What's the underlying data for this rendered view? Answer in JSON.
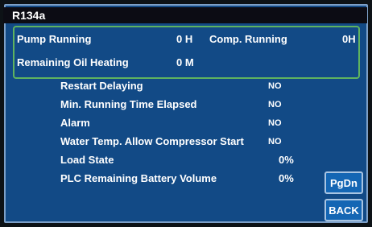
{
  "header": {
    "title": "R134a"
  },
  "status": {
    "pump_label": "Pump Running",
    "pump_value": "0 H",
    "comp_label": "Comp. Running",
    "comp_value": "0H",
    "oil_label": "Remaining Oil Heating",
    "oil_value": "0 M"
  },
  "conditions": [
    {
      "label": "Restart Delaying",
      "value": "NO"
    },
    {
      "label": "Min. Running Time Elapsed",
      "value": "NO"
    },
    {
      "label": "Alarm",
      "value": "NO"
    },
    {
      "label": "Water Temp. Allow Compressor Start",
      "value": "NO"
    },
    {
      "label": "Load State",
      "value": "0%"
    },
    {
      "label": "PLC Remaining Battery Volume",
      "value": "0%"
    }
  ],
  "buttons": {
    "pgdn": "PgDn",
    "back": "BACK"
  },
  "colors": {
    "panel": "#124a86",
    "status_border": "#5fb35f",
    "button": "#1466b4"
  }
}
